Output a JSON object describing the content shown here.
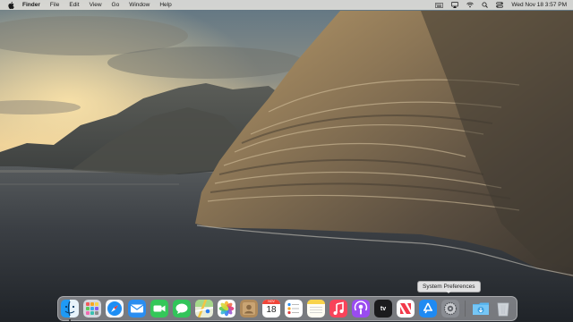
{
  "menubar": {
    "apple_icon": "apple-logo-icon",
    "app_name": "Finder",
    "items": [
      "File",
      "Edit",
      "View",
      "Go",
      "Window",
      "Help"
    ],
    "status_icons": [
      "keyboard-icon",
      "airplay-icon",
      "wifi-icon",
      "search-icon",
      "control-center-icon"
    ],
    "clock": "Wed Nov 18  3:57 PM"
  },
  "dock": {
    "apps": [
      {
        "name": "Finder",
        "icon": "finder-icon",
        "running": true
      },
      {
        "name": "Launchpad",
        "icon": "launchpad-icon",
        "running": false
      },
      {
        "name": "Safari",
        "icon": "safari-icon",
        "running": false
      },
      {
        "name": "Mail",
        "icon": "mail-icon",
        "running": false
      },
      {
        "name": "FaceTime",
        "icon": "facetime-icon",
        "running": false
      },
      {
        "name": "Messages",
        "icon": "messages-icon",
        "running": false
      },
      {
        "name": "Maps",
        "icon": "maps-icon",
        "running": false
      },
      {
        "name": "Photos",
        "icon": "photos-icon",
        "running": false
      },
      {
        "name": "Contacts",
        "icon": "contacts-icon",
        "running": false
      },
      {
        "name": "Calendar",
        "icon": "calendar-icon",
        "running": false
      },
      {
        "name": "Reminders",
        "icon": "reminders-icon",
        "running": false
      },
      {
        "name": "Notes",
        "icon": "notes-icon",
        "running": false
      },
      {
        "name": "Music",
        "icon": "music-icon",
        "running": false
      },
      {
        "name": "Podcasts",
        "icon": "podcasts-icon",
        "running": false
      },
      {
        "name": "TV",
        "icon": "apple-tv-icon",
        "running": false
      },
      {
        "name": "News",
        "icon": "news-icon",
        "running": false
      },
      {
        "name": "App Store",
        "icon": "app-store-icon",
        "running": false
      },
      {
        "name": "System Preferences",
        "icon": "system-preferences-icon",
        "running": false
      },
      {
        "name": "Downloads",
        "icon": "downloads-folder-icon",
        "running": false
      },
      {
        "name": "Trash",
        "icon": "trash-icon",
        "running": false
      }
    ],
    "calendar_month": "NOV",
    "calendar_day": "18",
    "tv_label": "tv",
    "tooltip": "System Preferences"
  },
  "colors": {
    "menubar_bg": "#ebe8e2",
    "sky_top": "#6b7f8c",
    "sky_glow": "#e9c98a",
    "sea": "#2f343a",
    "cliff_light": "#a58e68",
    "cliff_dark": "#3a342c"
  }
}
